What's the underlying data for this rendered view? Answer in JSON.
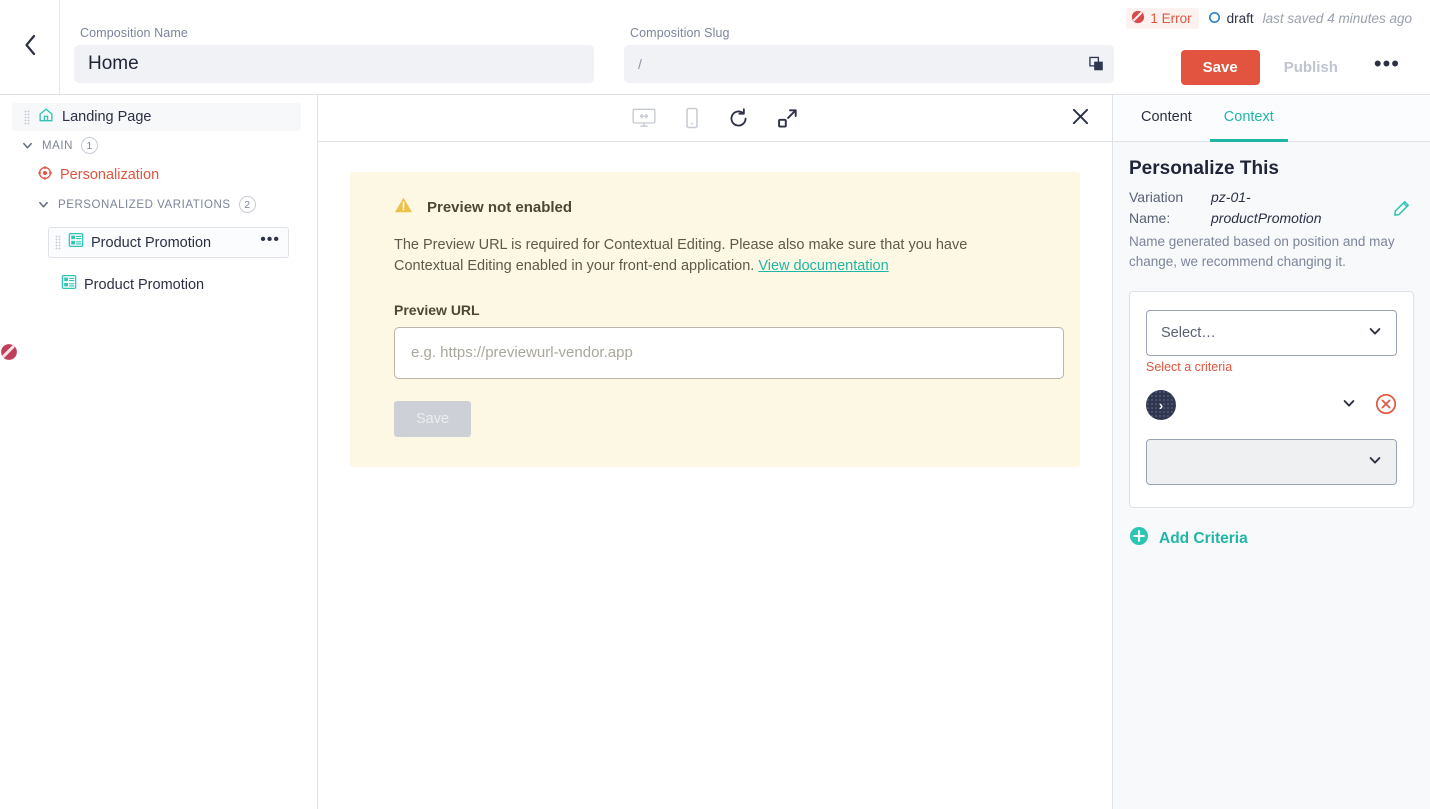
{
  "header": {
    "back_icon": "chevron-left-icon",
    "composition_name_label": "Composition Name",
    "composition_name_value": "Home",
    "composition_slug_label": "Composition Slug",
    "composition_slug_value": "/",
    "copy_icon": "copy-icon",
    "error_badge": {
      "icon": "error-circle-icon",
      "label": "1 Error",
      "color": "#e2543f"
    },
    "status": {
      "icon": "circle-outline-icon",
      "label": "draft",
      "color": "#2f80c8"
    },
    "last_saved": "last saved 4 minutes ago",
    "save_label": "Save",
    "publish_label": "Publish",
    "more_label": "•••"
  },
  "tree": {
    "page": {
      "icon": "home-icon",
      "label": "Landing Page"
    },
    "main_group": {
      "caret": "chevron-down-icon",
      "label": "MAIN",
      "count": "1"
    },
    "personalization": {
      "icon": "target-icon",
      "label": "Personalization"
    },
    "variations_group": {
      "caret": "chevron-down-icon",
      "label": "PERSONALIZED VARIATIONS",
      "count": "2"
    },
    "items": [
      {
        "icon": "component-icon",
        "label": "Product Promotion",
        "menu_icon": "ellipsis-icon",
        "selected": true,
        "has_error": true
      },
      {
        "icon": "component-icon",
        "label": "Product Promotion",
        "selected": false,
        "has_error": false
      }
    ],
    "error_flag_icon": "error-circle-icon"
  },
  "preview": {
    "toolbar": {
      "desktop_icon": "desktop-responsive-icon",
      "mobile_icon": "mobile-device-icon",
      "refresh_icon": "refresh-icon",
      "expand_icon": "expand-diagonal-icon",
      "close_icon": "close-x-icon"
    },
    "warning": {
      "icon": "warning-triangle-icon",
      "title": "Preview not enabled",
      "body": "The Preview URL is required for Contextual Editing. Please also make sure that you have Contextual Editing enabled in your front-end application.",
      "link_label": "View documentation",
      "url_field_label": "Preview URL",
      "url_placeholder": "e.g. https://previewurl-vendor.app",
      "url_value": "",
      "save_label": "Save"
    }
  },
  "right_panel": {
    "tabs": [
      {
        "label": "Content",
        "active": false
      },
      {
        "label": "Context",
        "active": true
      }
    ],
    "title": "Personalize This",
    "variation_name_label_line1": "Variation",
    "variation_name_label_line2": "Name:",
    "variation_name_value_line1": "pz-01-",
    "variation_name_value_line2": "productPromotion",
    "edit_icon": "pencil-icon",
    "note": "Name generated based on position and may change, we recommend changing it.",
    "criteria": {
      "select_placeholder": "Select…",
      "select_value": "",
      "error_message": "Select a criteria",
      "operator_badge": "›",
      "operator_value": "",
      "value_select": "",
      "remove_icon": "remove-circle-icon",
      "chevron_icon": "chevron-down-icon"
    },
    "add_criteria": {
      "icon": "plus-circle-icon",
      "label": "Add Criteria"
    }
  }
}
